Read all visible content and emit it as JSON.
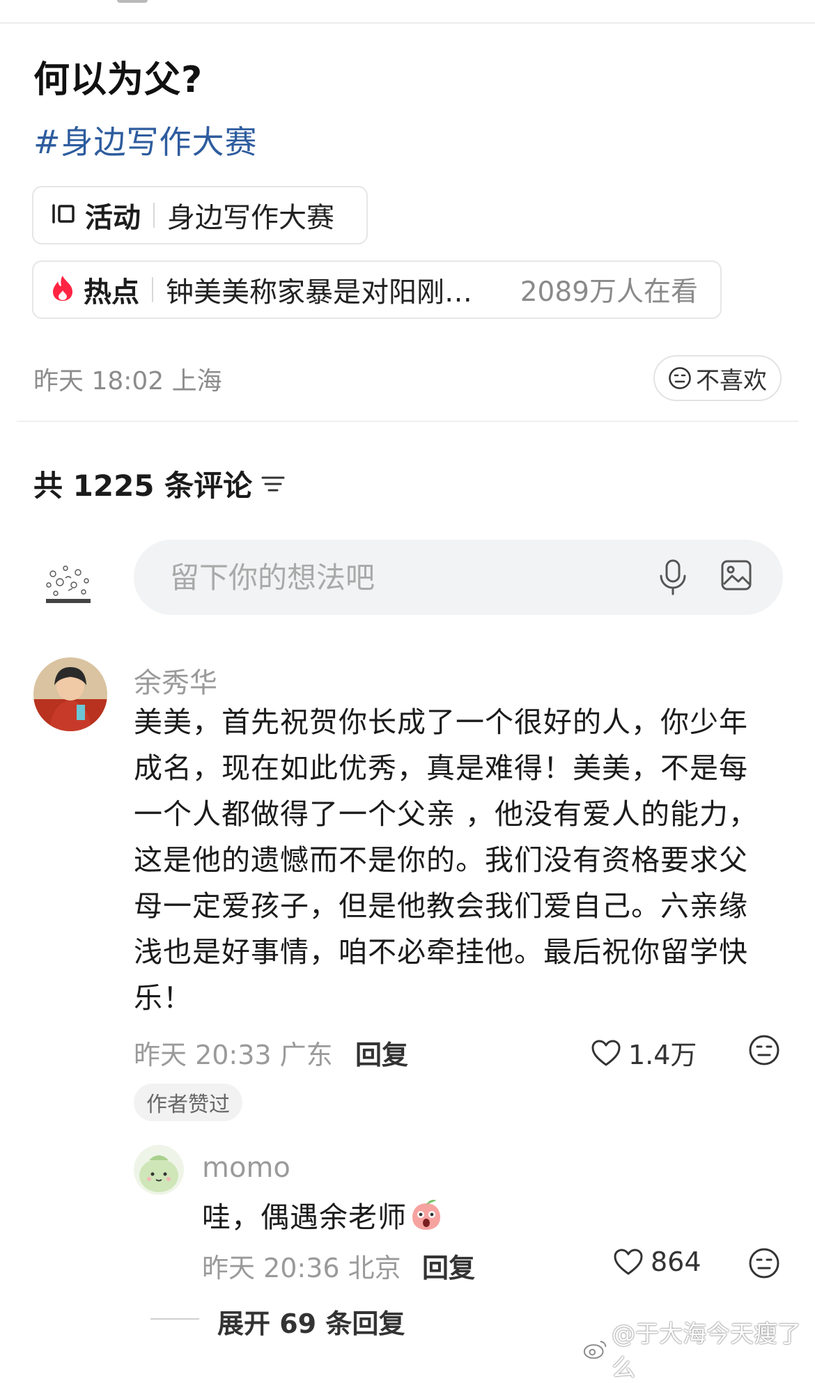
{
  "post": {
    "title": "何以为父?",
    "topic_tag": "#身边写作大赛",
    "activity_chip": {
      "label": "活动",
      "text": "身边写作大赛"
    },
    "hot_chip": {
      "label": "热点",
      "text": "钟美美称家暴是对阳刚…",
      "count": "2089万人在看"
    },
    "meta": "昨天 18:02 上海",
    "dislike_label": "不喜欢"
  },
  "comments_section": {
    "header": "共 1225 条评论",
    "input_placeholder": "留下你的想法吧",
    "icons": [
      "filter-icon",
      "mic-icon",
      "image-icon"
    ]
  },
  "comments": [
    {
      "name": "余秀华",
      "text": "美美，首先祝贺你长成了一个很好的人，你少年成名，现在如此优秀，真是难得！美美，不是每一个人都做得了一个父亲 ，他没有爱人的能力，这是他的遗憾而不是你的。我们没有资格要求父母一定爱孩子，但是他教会我们爱自己。六亲缘浅也是好事情，咱不必牵挂他。最后祝你留学快乐！",
      "meta": "昨天 20:33 广东",
      "reply_label": "回复",
      "likes": "1.4万",
      "badge": "作者赞过"
    },
    {
      "name": "momo",
      "text": "哇，偶遇余老师",
      "meta": "昨天 20:36 北京",
      "reply_label": "回复",
      "likes": "864"
    }
  ],
  "expand_replies": "展开 69 条回复",
  "watermark": "@于大海今天瘦了么",
  "colors": {
    "tag_blue": "#2e5c9e",
    "flame_red": "#ff2442",
    "muted": "#9a9a9a"
  }
}
